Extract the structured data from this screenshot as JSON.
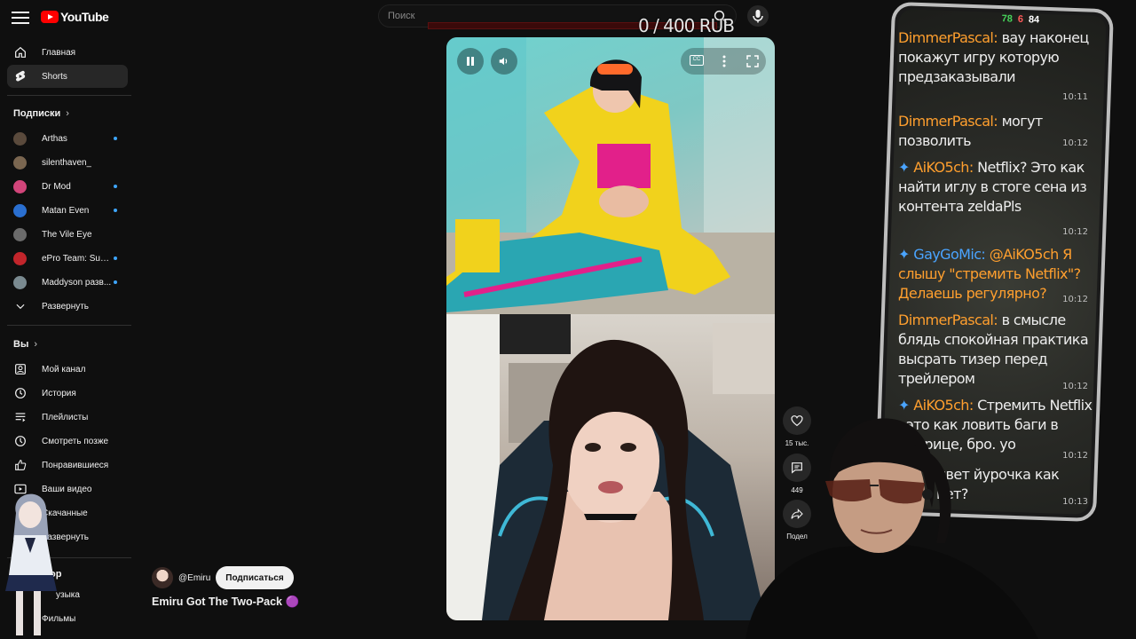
{
  "header": {
    "logo_text": "YouTube",
    "search_placeholder": "Поиск"
  },
  "donation": {
    "text": "0 / 400 RUB",
    "progress": 0.0
  },
  "sidebar": {
    "main": [
      {
        "label": "Главная",
        "icon": "home-icon"
      },
      {
        "label": "Shorts",
        "icon": "shorts-icon",
        "active": true
      }
    ],
    "subscriptions_title": "Подписки",
    "subscriptions": [
      {
        "label": "Arthas",
        "color": "#5a4a3c",
        "live": true
      },
      {
        "label": "silenthaven_",
        "color": "#7a6650",
        "live": false
      },
      {
        "label": "Dr Mod",
        "color": "#d2457a",
        "live": true
      },
      {
        "label": "Matan Even",
        "color": "#2a6fd0",
        "live": true
      },
      {
        "label": "The Vile Eye",
        "color": "#6b6b6b",
        "live": false
      },
      {
        "label": "ePro Team: Supp...",
        "color": "#c2252b",
        "live": true
      },
      {
        "label": "Maddyson разв...",
        "color": "#7a8a90",
        "live": true
      }
    ],
    "expand_label": "Развернуть",
    "you_title": "Вы",
    "you": [
      {
        "label": "Мой канал",
        "icon": "channel-icon"
      },
      {
        "label": "История",
        "icon": "history-icon"
      },
      {
        "label": "Плейлисты",
        "icon": "playlists-icon"
      },
      {
        "label": "Смотреть позже",
        "icon": "watch-later-icon"
      },
      {
        "label": "Понравившиеся",
        "icon": "like-icon"
      },
      {
        "label": "Ваши видео",
        "icon": "your-videos-icon"
      },
      {
        "label": "Скачанные",
        "icon": "downloads-icon"
      },
      {
        "label": "Развернуть",
        "icon": "chevron-down-icon"
      }
    ],
    "partial_section_title": "ор",
    "partial_items": [
      "узыка",
      "Фильмы"
    ]
  },
  "short": {
    "channel": "@Emiru",
    "subscribe_label": "Подписаться",
    "title": "Emiru Got The Two-Pack",
    "title_emoji": "🟣",
    "likes": "15 тыс.",
    "comments": "449",
    "share": "Подел"
  },
  "chat": {
    "status": {
      "green": "78",
      "red": "6",
      "white": "84"
    },
    "messages": [
      {
        "user": "DimmerPascal:",
        "text": " вау наконец покажут игру которую предзаказывали",
        "time": "10:11",
        "user_color": "orange"
      },
      {
        "user": "DimmerPascal:",
        "text": " могут позволить",
        "time": "10:12",
        "user_color": "orange"
      },
      {
        "user": "AiKO5ch:",
        "text": " Netflix? Это как найти иглу в стоге сена из контента zeldaPls",
        "time": "10:12",
        "user_color": "orange",
        "badge": true
      },
      {
        "user": "GayGoMic:",
        "text": " @AiKO5ch Я слышу \"стремить Netflix\"? Делаешь регулярно?",
        "time": "10:12",
        "user_color": "blue",
        "badge": true
      },
      {
        "user": "DimmerPascal:",
        "text": " в смысле блядь спокойная практика высрать тизер перед трейлером",
        "time": "10:12",
        "user_color": "orange"
      },
      {
        "user": "AiKO5ch:",
        "text": " Стремить Netflix , это как ловить баги в матрице, бро. уо",
        "time": "10:12",
        "user_color": "orange",
        "badge": true
      },
      {
        "user": "...:",
        "text": " Привет йурочка как дела нет?",
        "time": "10:13",
        "user_color": "orange"
      }
    ]
  }
}
